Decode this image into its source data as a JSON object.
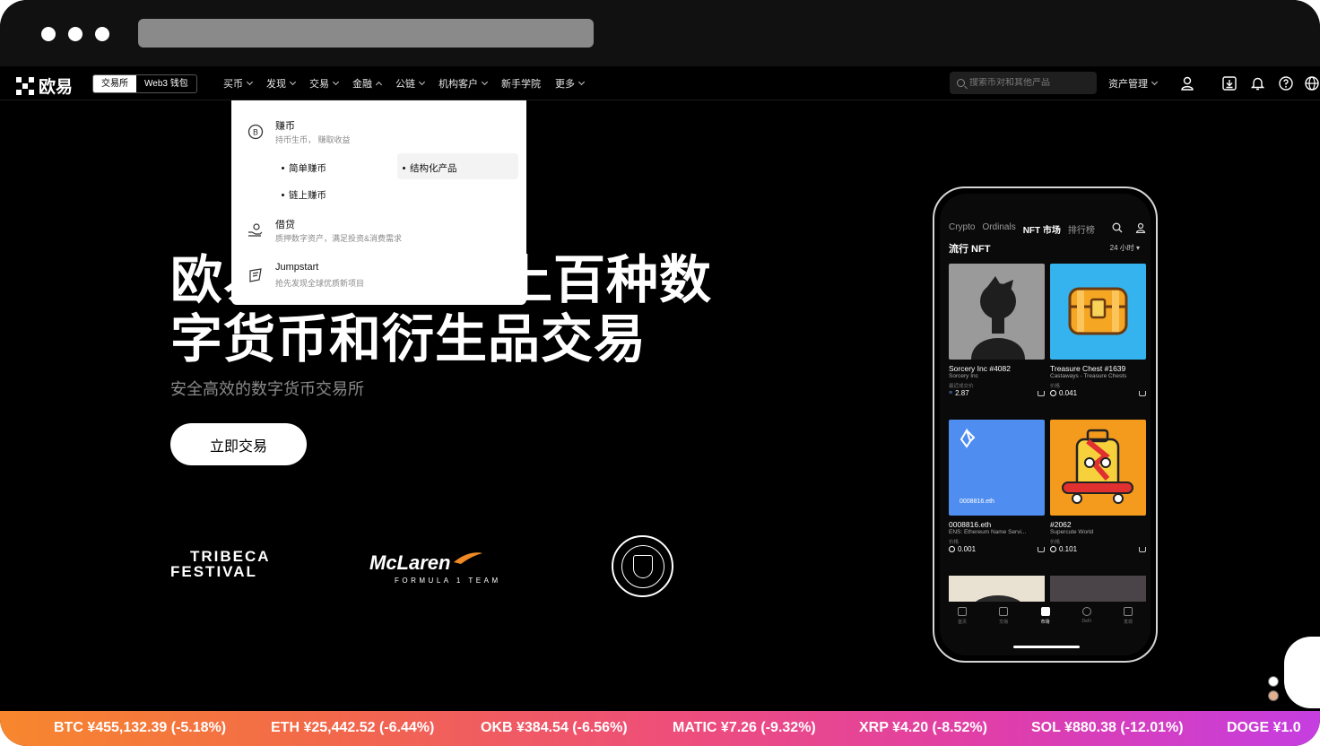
{
  "nav": {
    "logo_text": "欧易",
    "segments": [
      "交易所",
      "Web3 钱包"
    ],
    "menu": [
      "买币",
      "发现",
      "交易",
      "金融",
      "公链",
      "机构客户",
      "新手学院",
      "更多"
    ],
    "search_placeholder": "搜索币对和其他产品",
    "asset_label": "资产管理"
  },
  "dropdown": {
    "sections": [
      {
        "title": "赚币",
        "subtitle": "持币生币， 赚取收益",
        "icon": "bitcoin-coin-icon"
      },
      {
        "title": "借贷",
        "subtitle": "质押数字资产，满足投资&消费需求",
        "icon": "hand-coin-icon"
      },
      {
        "title": "Jumpstart",
        "subtitle": "抢先发现全球优质新项目",
        "icon": "rocket-icon"
      }
    ],
    "links": [
      "简单赚币",
      "结构化产品",
      "链上赚币"
    ]
  },
  "hero": {
    "title": "欧易 上百种数字货币和衍生品交易",
    "title_line1_a": "欧易",
    "title_line1_b": "上百种数",
    "title_line2": "字货币和衍生品交易",
    "subtitle": "安全高效的数字货币交易所",
    "cta": "立即交易"
  },
  "partners": {
    "tribeca_line1": "TRIBECA",
    "tribeca_line2": "FESTIVAL",
    "mclaren_name": "McLaren",
    "mclaren_tag": "FORMULA 1 TEAM",
    "mancity": "MANCHESTER CITY"
  },
  "phone": {
    "tabs": [
      "Crypto",
      "Ordinals",
      "NFT 市场",
      "排行榜"
    ],
    "heading": "流行 NFT",
    "range": "24 小时",
    "cards": [
      {
        "title": "Sorcery Inc #4082",
        "sub": "Sorcery Inc",
        "label": "最近成交价",
        "price": "2.87"
      },
      {
        "title": "Treasure Chest #1639",
        "sub": "Castaways - Treasure Chests",
        "label": "价格",
        "price": "0.041"
      },
      {
        "title": "0008816.eth",
        "sub": "ENS: Ethereum Name Servi...",
        "label": "价格",
        "price": "0.001",
        "overlay": "0008816.eth"
      },
      {
        "title": "#2062",
        "sub": "Supercute World",
        "label": "价格",
        "price": "0.101"
      }
    ],
    "bottom_nav": [
      "首页",
      "交易",
      "市场",
      "DeFi",
      "发现"
    ]
  },
  "ticker": [
    "BTC ¥455,132.39 (-5.18%)",
    "ETH ¥25,442.52 (-6.44%)",
    "OKB ¥384.54 (-6.56%)",
    "MATIC ¥7.26 (-9.32%)",
    "XRP ¥4.20 (-8.52%)",
    "SOL ¥880.38 (-12.01%)",
    "DOGE ¥1.0"
  ],
  "colors": {
    "ticker_start": "#f7872e",
    "ticker_end": "#c53ee0",
    "background": "#000000",
    "card_blue": "#4f8ef0",
    "card_orange": "#f49a1c",
    "card_sky": "#35b3ee"
  }
}
